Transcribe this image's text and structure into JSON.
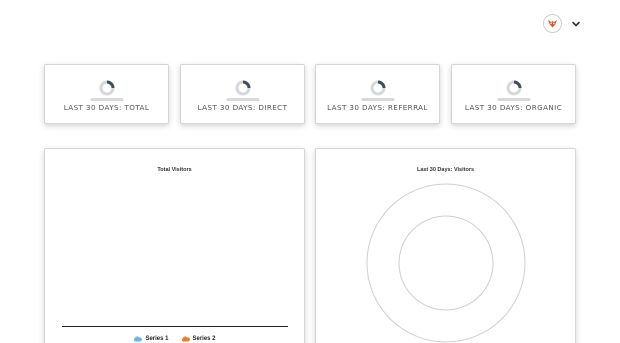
{
  "header": {
    "avatar_icon": "fox-logo-icon",
    "menu_icon": "chevron-down-icon",
    "avatar_color": "#e0562a"
  },
  "stats": [
    {
      "label": "LAST 30 DAYS: TOTAL",
      "status": "loading"
    },
    {
      "label": "LAST 30 DAYS: DIRECT",
      "status": "loading"
    },
    {
      "label": "LAST 30 DAYS: REFERRAL",
      "status": "loading"
    },
    {
      "label": "LAST 30 DAYS: ORGANIC",
      "status": "loading"
    }
  ],
  "panels": {
    "total_visitors": {
      "title": "Total Visitors",
      "legend": [
        {
          "name": "Series 1",
          "color": "#6ab4e6",
          "icon": "cloud-icon"
        },
        {
          "name": "Series 2",
          "color": "#f07b2a",
          "icon": "cloud-icon"
        }
      ]
    },
    "last30_visitors": {
      "title": "Last 30 Days: Visitors"
    }
  }
}
